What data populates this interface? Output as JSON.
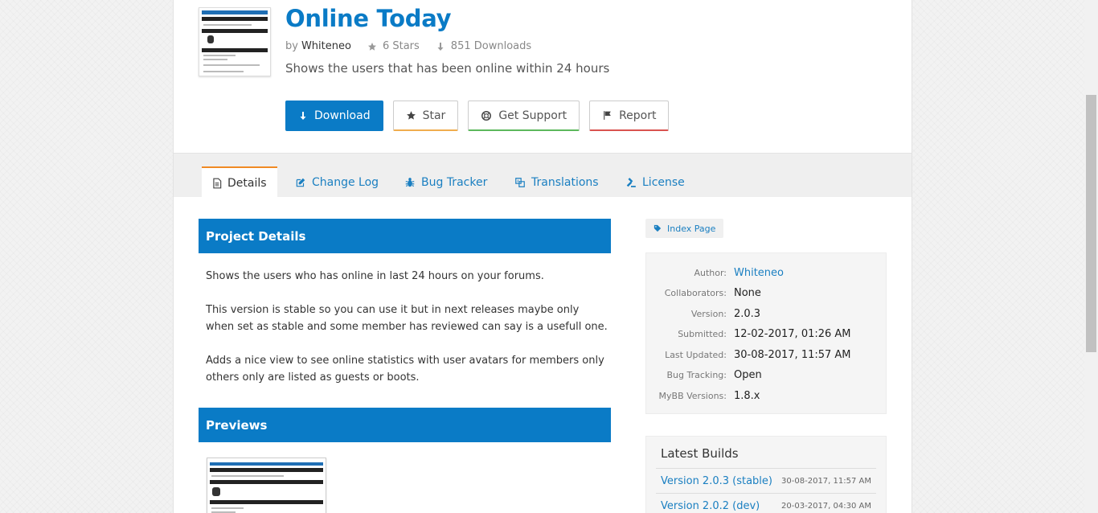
{
  "header": {
    "title": "Online Today",
    "by_label": "by",
    "author": "Whiteneo",
    "stars": "6 Stars",
    "downloads": "851 Downloads",
    "description": "Shows the users that has been online within 24 hours"
  },
  "actions": {
    "download": "Download",
    "star": "Star",
    "support": "Get Support",
    "report": "Report"
  },
  "tabs": [
    {
      "label": "Details",
      "icon": "document-icon"
    },
    {
      "label": "Change Log",
      "icon": "edit-icon"
    },
    {
      "label": "Bug Tracker",
      "icon": "bug-icon"
    },
    {
      "label": "Translations",
      "icon": "translate-icon"
    },
    {
      "label": "License",
      "icon": "gavel-icon"
    }
  ],
  "project_details": {
    "heading": "Project Details",
    "paragraphs": [
      "Shows the users who has online in last 24 hours on your forums.",
      "This version is stable so you can use it but in next releases maybe only when set as stable and some member has reviewed can say is a usefull one.",
      "Adds a nice view to see online statistics with user avatars for members only others only are listed as guests or boots."
    ]
  },
  "previews": {
    "heading": "Previews"
  },
  "sidebar": {
    "tag": "Index Page",
    "info": [
      {
        "key": "Author:",
        "value": "Whiteneo"
      },
      {
        "key": "Collaborators:",
        "value": "None"
      },
      {
        "key": "Version:",
        "value": "2.0.3"
      },
      {
        "key": "Submitted:",
        "value": "12-02-2017, 01:26 AM"
      },
      {
        "key": "Last Updated:",
        "value": "30-08-2017, 11:57 AM"
      },
      {
        "key": "Bug Tracking:",
        "value": "Open"
      },
      {
        "key": "MyBB Versions:",
        "value": "1.8.x"
      }
    ],
    "latest_builds": {
      "heading": "Latest Builds",
      "items": [
        {
          "name": "Version 2.0.3 (stable)",
          "date": "30-08-2017, 11:57 AM"
        },
        {
          "name": "Version 2.0.2 (dev)",
          "date": "20-03-2017, 04:30 AM"
        }
      ]
    }
  },
  "colors": {
    "primary": "#0a7bc6",
    "star_accent": "#f0ad4e",
    "support_accent": "#5cb85c",
    "report_accent": "#d9534f",
    "active_tab_accent": "#f08a24"
  }
}
